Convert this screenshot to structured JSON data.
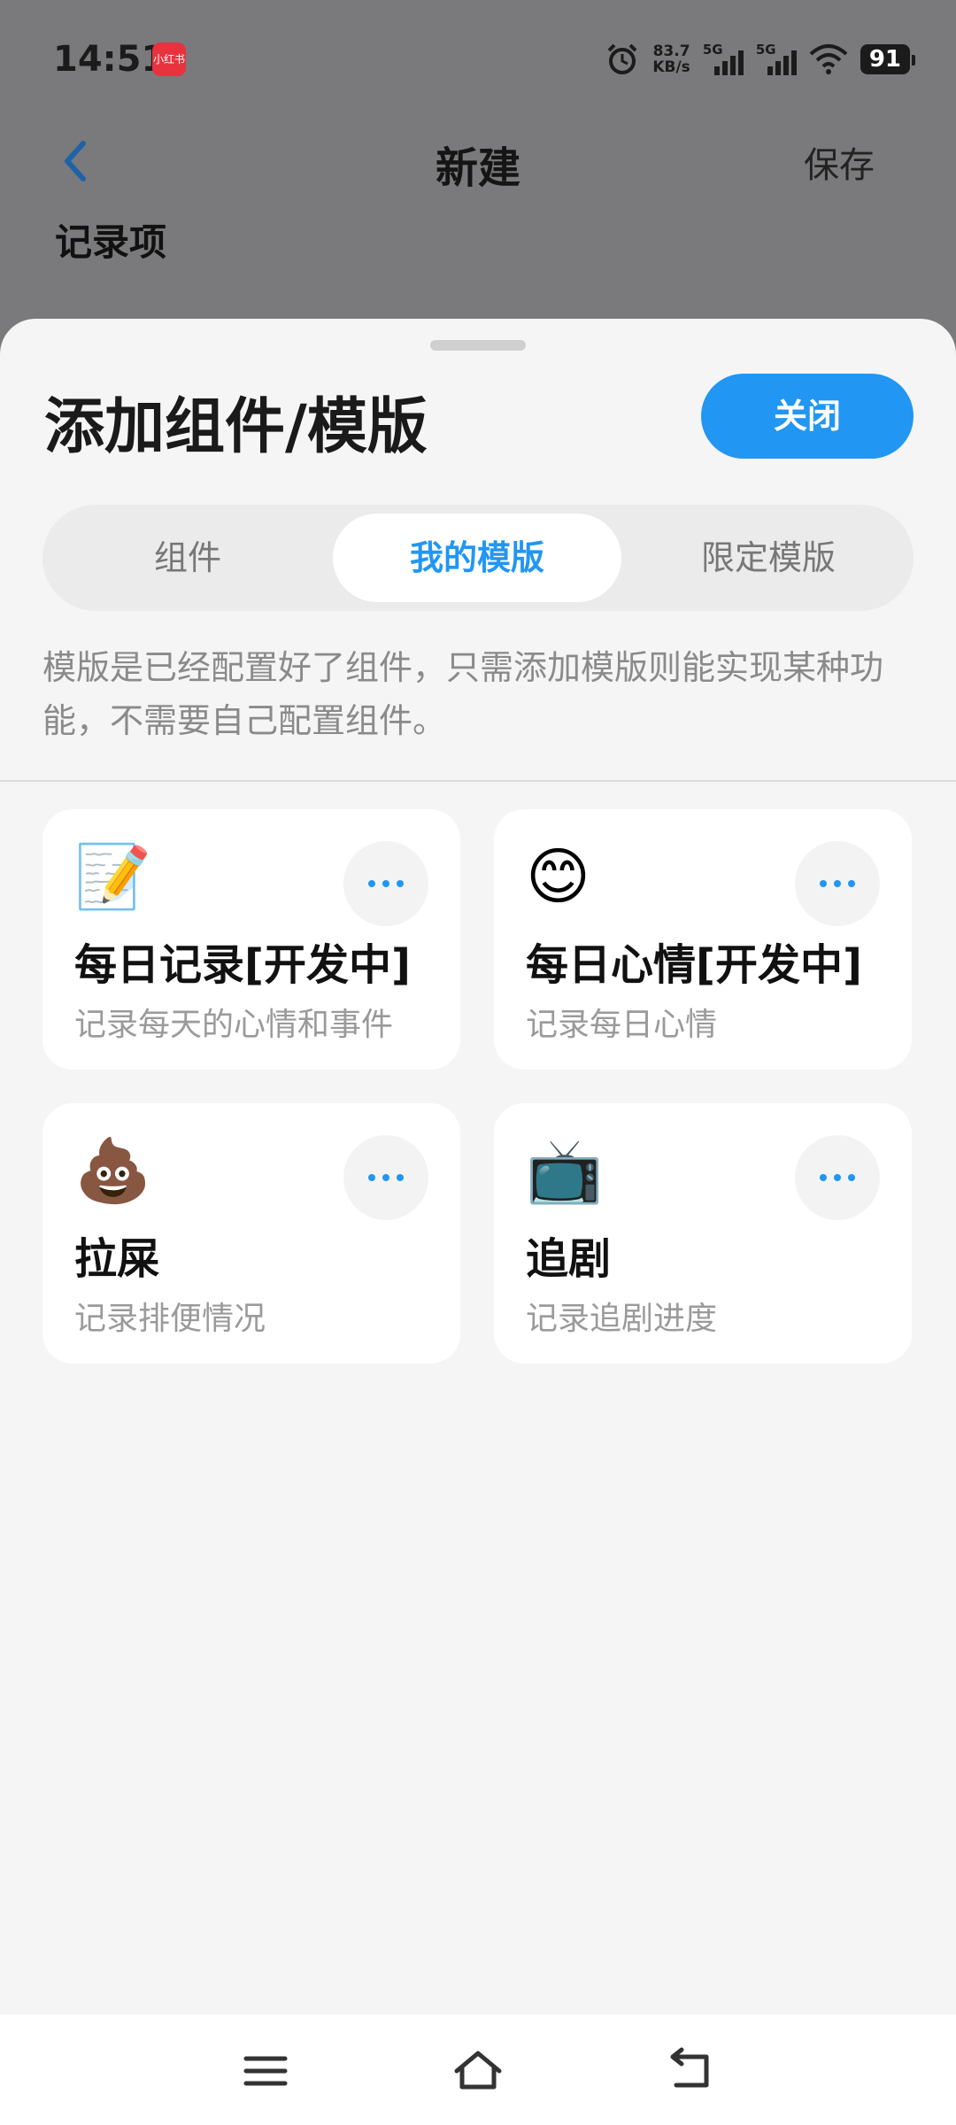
{
  "status_bar": {
    "time": "14:51",
    "app_badge": "小红书",
    "net_speed_value": "83.7",
    "net_speed_unit": "KB/s",
    "signal1_label": "5G",
    "signal2_label": "5G",
    "battery": "91"
  },
  "header": {
    "title": "新建",
    "save_label": "保存",
    "section_label": "记录项"
  },
  "sheet": {
    "title": "添加组件/模版",
    "close_label": "关闭",
    "tabs": [
      {
        "label": "组件",
        "active": false
      },
      {
        "label": "我的模版",
        "active": true
      },
      {
        "label": "限定模版",
        "active": false
      }
    ],
    "description": "模版是已经配置好了组件，只需添加模版则能实现某种功能，不需要自己配置组件。",
    "templates": [
      {
        "emoji": "📝",
        "icon": "memo-icon",
        "name": "每日记录[开发中]",
        "desc": "记录每天的心情和事件"
      },
      {
        "emoji": "😊",
        "icon": "smiling-face-icon",
        "name": "每日心情[开发中]",
        "desc": "记录每日心情"
      },
      {
        "emoji": "💩",
        "icon": "poop-icon",
        "name": "拉屎",
        "desc": "记录排便情况"
      },
      {
        "emoji": "📺",
        "icon": "television-icon",
        "name": "追剧",
        "desc": "记录追剧进度"
      }
    ]
  },
  "colors": {
    "accent": "#2196f3",
    "overlay": "#7a7a7c",
    "sheet_bg": "#f5f5f5"
  }
}
